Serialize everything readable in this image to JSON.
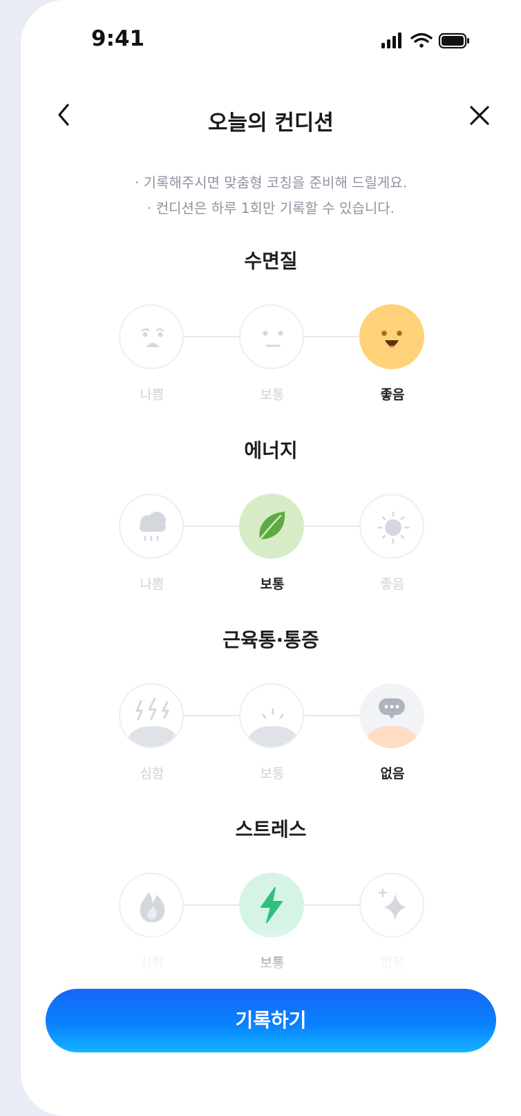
{
  "status": {
    "time": "9:41"
  },
  "nav": {
    "title": "오늘의 컨디션"
  },
  "notice": {
    "line1": "· 기록해주시면 맞춤형 코칭을 준비해 드릴게요.",
    "line2": "· 컨디션은 하루 1회만 기록할 수 있습니다."
  },
  "sections": [
    {
      "title": "수면질",
      "options": [
        {
          "label": "나쁨",
          "icon": "sad-face-icon",
          "selected": false
        },
        {
          "label": "보통",
          "icon": "neutral-face-icon",
          "selected": false
        },
        {
          "label": "좋음",
          "icon": "smile-face-icon",
          "selected": true
        }
      ]
    },
    {
      "title": "에너지",
      "options": [
        {
          "label": "나쁨",
          "icon": "rain-cloud-icon",
          "selected": false
        },
        {
          "label": "보통",
          "icon": "leaf-icon",
          "selected": true
        },
        {
          "label": "좋음",
          "icon": "sun-icon",
          "selected": false
        }
      ]
    },
    {
      "title": "근육통·통증",
      "options": [
        {
          "label": "심함",
          "icon": "strong-pain-icon",
          "selected": false
        },
        {
          "label": "보통",
          "icon": "mild-pain-icon",
          "selected": false
        },
        {
          "label": "없음",
          "icon": "no-pain-icon",
          "selected": true
        }
      ]
    },
    {
      "title": "스트레스",
      "options": [
        {
          "label": "심함",
          "icon": "fire-icon",
          "selected": false
        },
        {
          "label": "보통",
          "icon": "lightning-icon",
          "selected": true
        },
        {
          "label": "없음",
          "icon": "sparkle-icon",
          "selected": false
        }
      ]
    }
  ],
  "cta": {
    "label": "기록하기"
  },
  "colors": {
    "sleep_selected": "#ffd27a",
    "energy_selected": "#d7ecc6",
    "leaf": "#5bab43",
    "pain_selected_bg": "#f1f3f7",
    "pain_selected_skin": "#ffdcc2",
    "stress_selected": "#d5f4e6",
    "bolt": "#2fbf7e",
    "primary": "#0a80ff"
  }
}
